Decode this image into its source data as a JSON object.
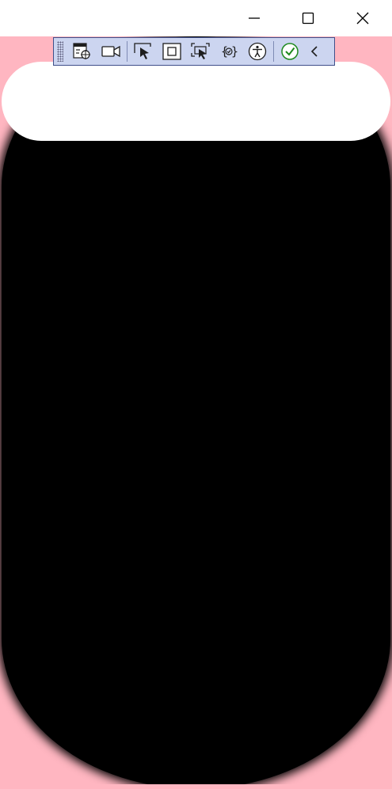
{
  "window": {
    "controls": {
      "minimize_icon": "minimize-icon",
      "maximize_icon": "maximize-icon",
      "close_icon": "close-icon"
    }
  },
  "content": {
    "background_color": "#ffb6c1",
    "blob_color": "#000000",
    "banner_color": "#ffffff"
  },
  "toolbar": {
    "background_color": "#ccd5f0",
    "border_color": "#3f4f8a",
    "buttons": [
      {
        "icon": "live-visual-tree-icon"
      },
      {
        "icon": "record-video-icon"
      },
      {
        "icon": "select-element-icon"
      },
      {
        "icon": "display-layout-adorners-icon"
      },
      {
        "icon": "track-focused-element-icon"
      },
      {
        "icon": "binding-failures-icon"
      },
      {
        "icon": "accessibility-checker-icon"
      },
      {
        "icon": "hot-reload-ok-icon"
      },
      {
        "icon": "collapse-toolbar-icon"
      }
    ]
  }
}
